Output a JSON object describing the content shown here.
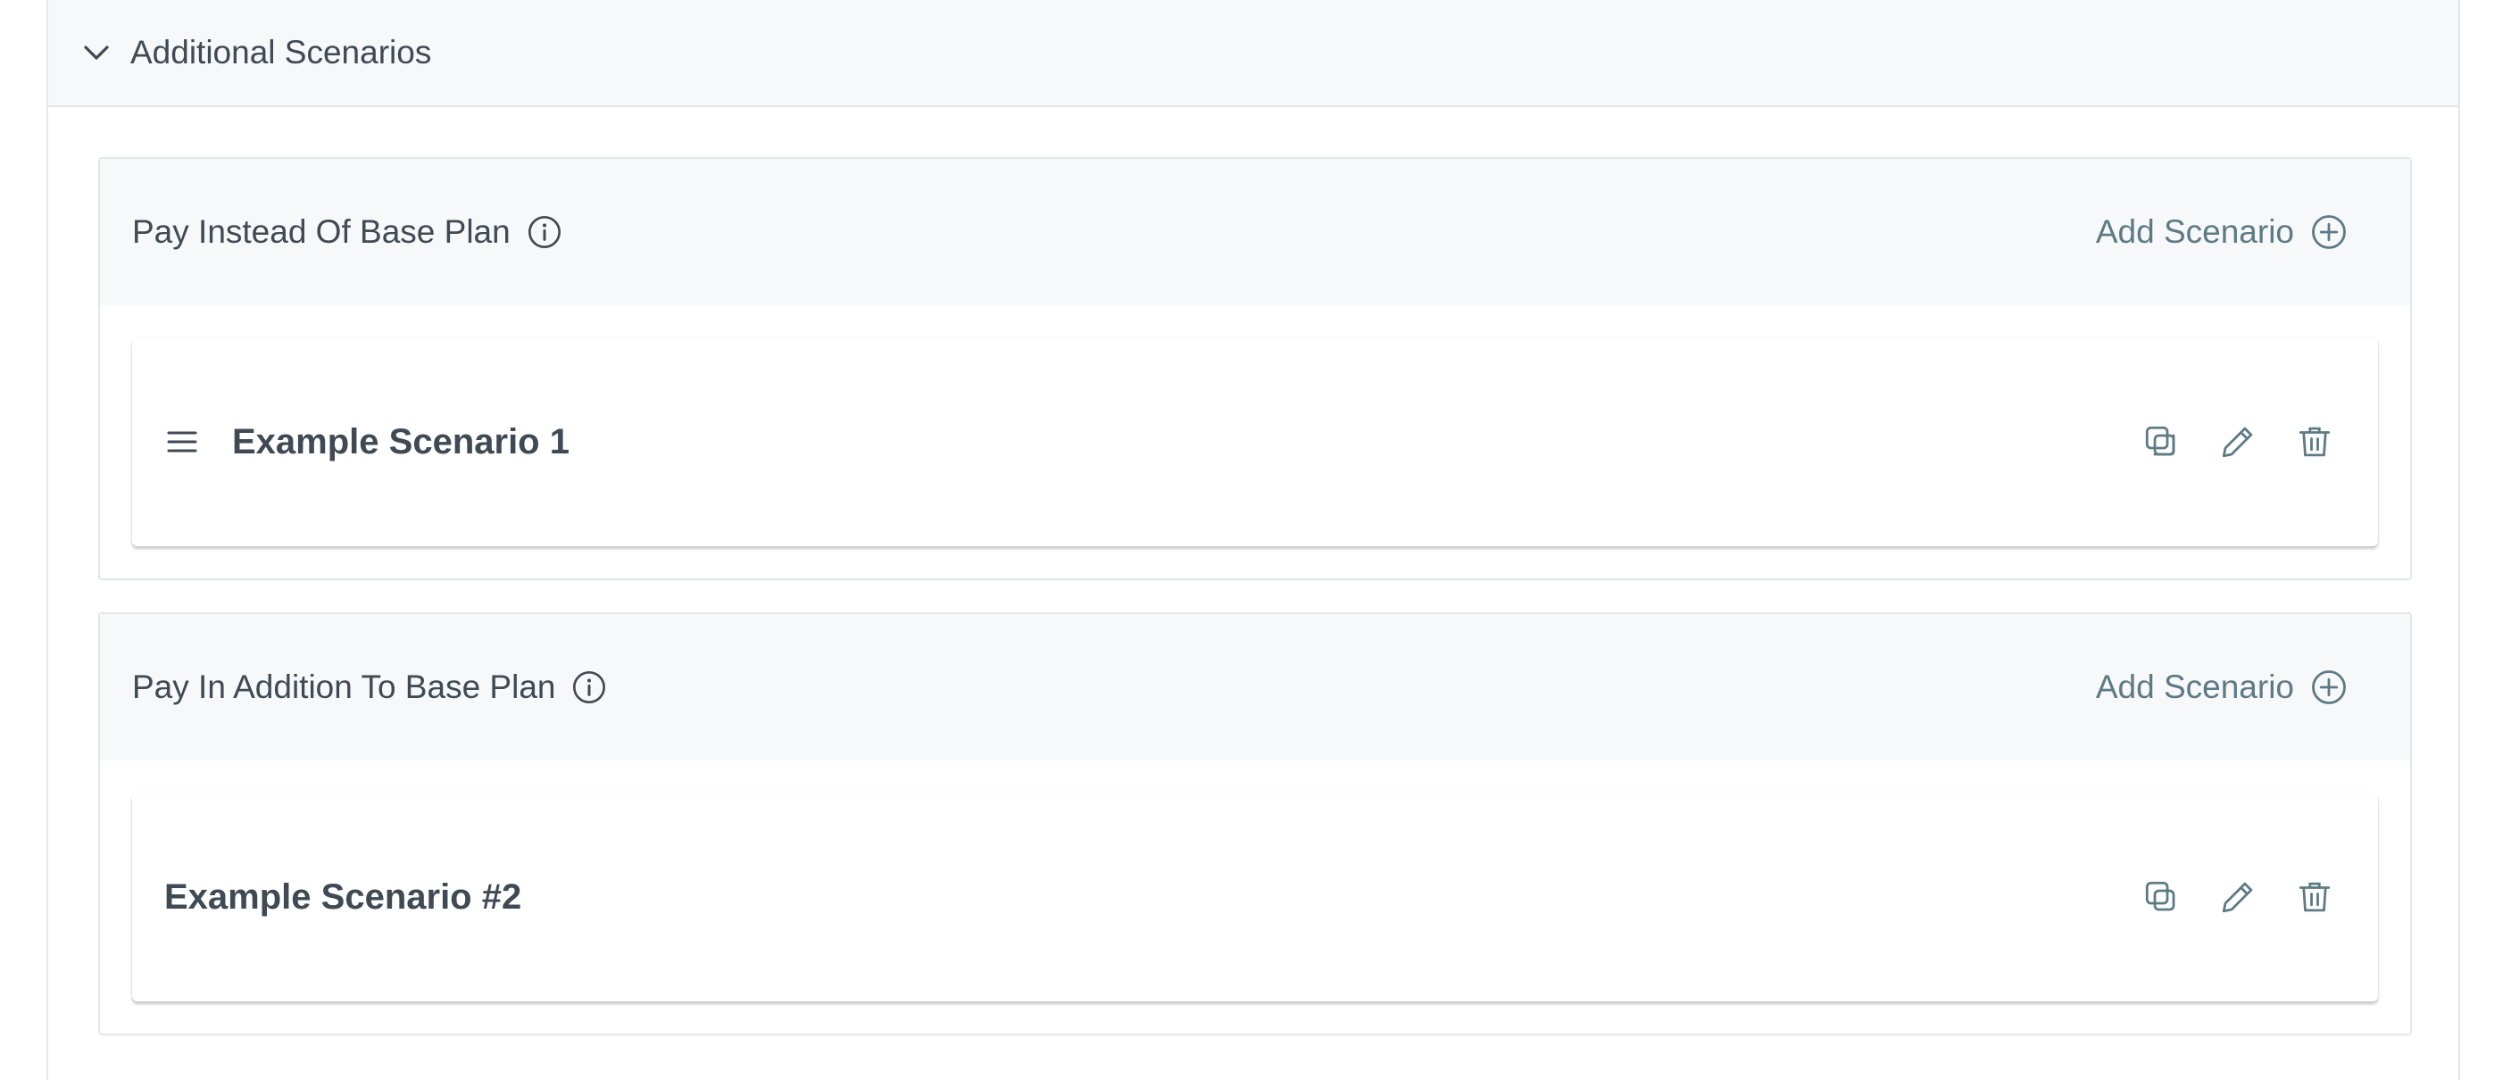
{
  "panel": {
    "title": "Additional Scenarios",
    "toggle_icon": "chevron-down-icon"
  },
  "sections": [
    {
      "title": "Pay Instead Of Base Plan",
      "info_icon": "info-icon",
      "add_label": "Add Scenario",
      "add_icon": "plus-circle-icon",
      "scenarios": [
        {
          "title": "Example Scenario 1",
          "has_drag_handle": true,
          "actions": [
            "copy-icon",
            "edit-pencil-icon",
            "trash-icon"
          ]
        }
      ]
    },
    {
      "title": "Pay In Addition To Base Plan",
      "info_icon": "info-icon",
      "add_label": "Add Scenario",
      "add_icon": "plus-circle-icon",
      "scenarios": [
        {
          "title": "Example Scenario #2",
          "has_drag_handle": false,
          "actions": [
            "copy-icon",
            "edit-pencil-icon",
            "trash-icon"
          ]
        }
      ]
    }
  ],
  "colors": {
    "text": "#3f4a54",
    "link": "#5d7a85",
    "header_bg": "#f7f8f9",
    "border": "#e3e7eb"
  }
}
